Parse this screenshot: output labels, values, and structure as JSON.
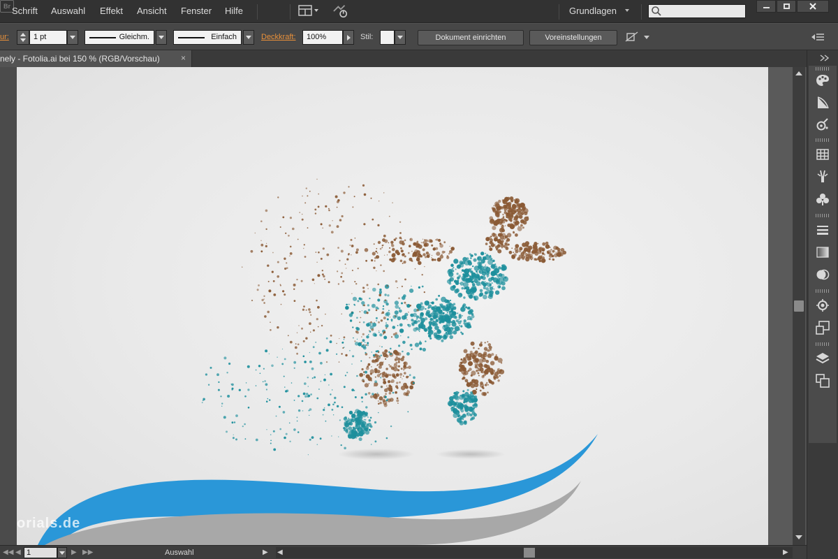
{
  "menu": {
    "items": [
      "Schrift",
      "Auswahl",
      "Effekt",
      "Ansicht",
      "Fenster",
      "Hilfe"
    ],
    "bridge_label": "Br",
    "workspace": "Grundlagen",
    "search_placeholder": ""
  },
  "controlbar": {
    "stroke_label": "ur:",
    "stroke_weight": "1 pt",
    "profile_label": "Gleichm.",
    "brush_label": "Einfach",
    "opacity_label": "Deckkraft:",
    "opacity_value": "100%",
    "style_label": "Stil:",
    "document_setup": "Dokument einrichten",
    "preferences": "Voreinstellungen"
  },
  "document": {
    "tab_title": "nely - Fotolia.ai bei 150 % (RGB/Vorschau)",
    "close_glyph": "×"
  },
  "canvas": {
    "watermark": "orials.de"
  },
  "statusbar": {
    "zoom": "1",
    "tool": "Auswahl",
    "nav_first": "◀◀",
    "nav_prev": "◀",
    "nav_next": "▶",
    "nav_last": "▶▶"
  },
  "colors": {
    "accent_orange": "#e8903a",
    "swoosh_blue": "#2a97d8",
    "swoosh_gray": "#a8a8a8",
    "particle_brown": "#8a5a35",
    "particle_teal": "#1d8f9c"
  }
}
